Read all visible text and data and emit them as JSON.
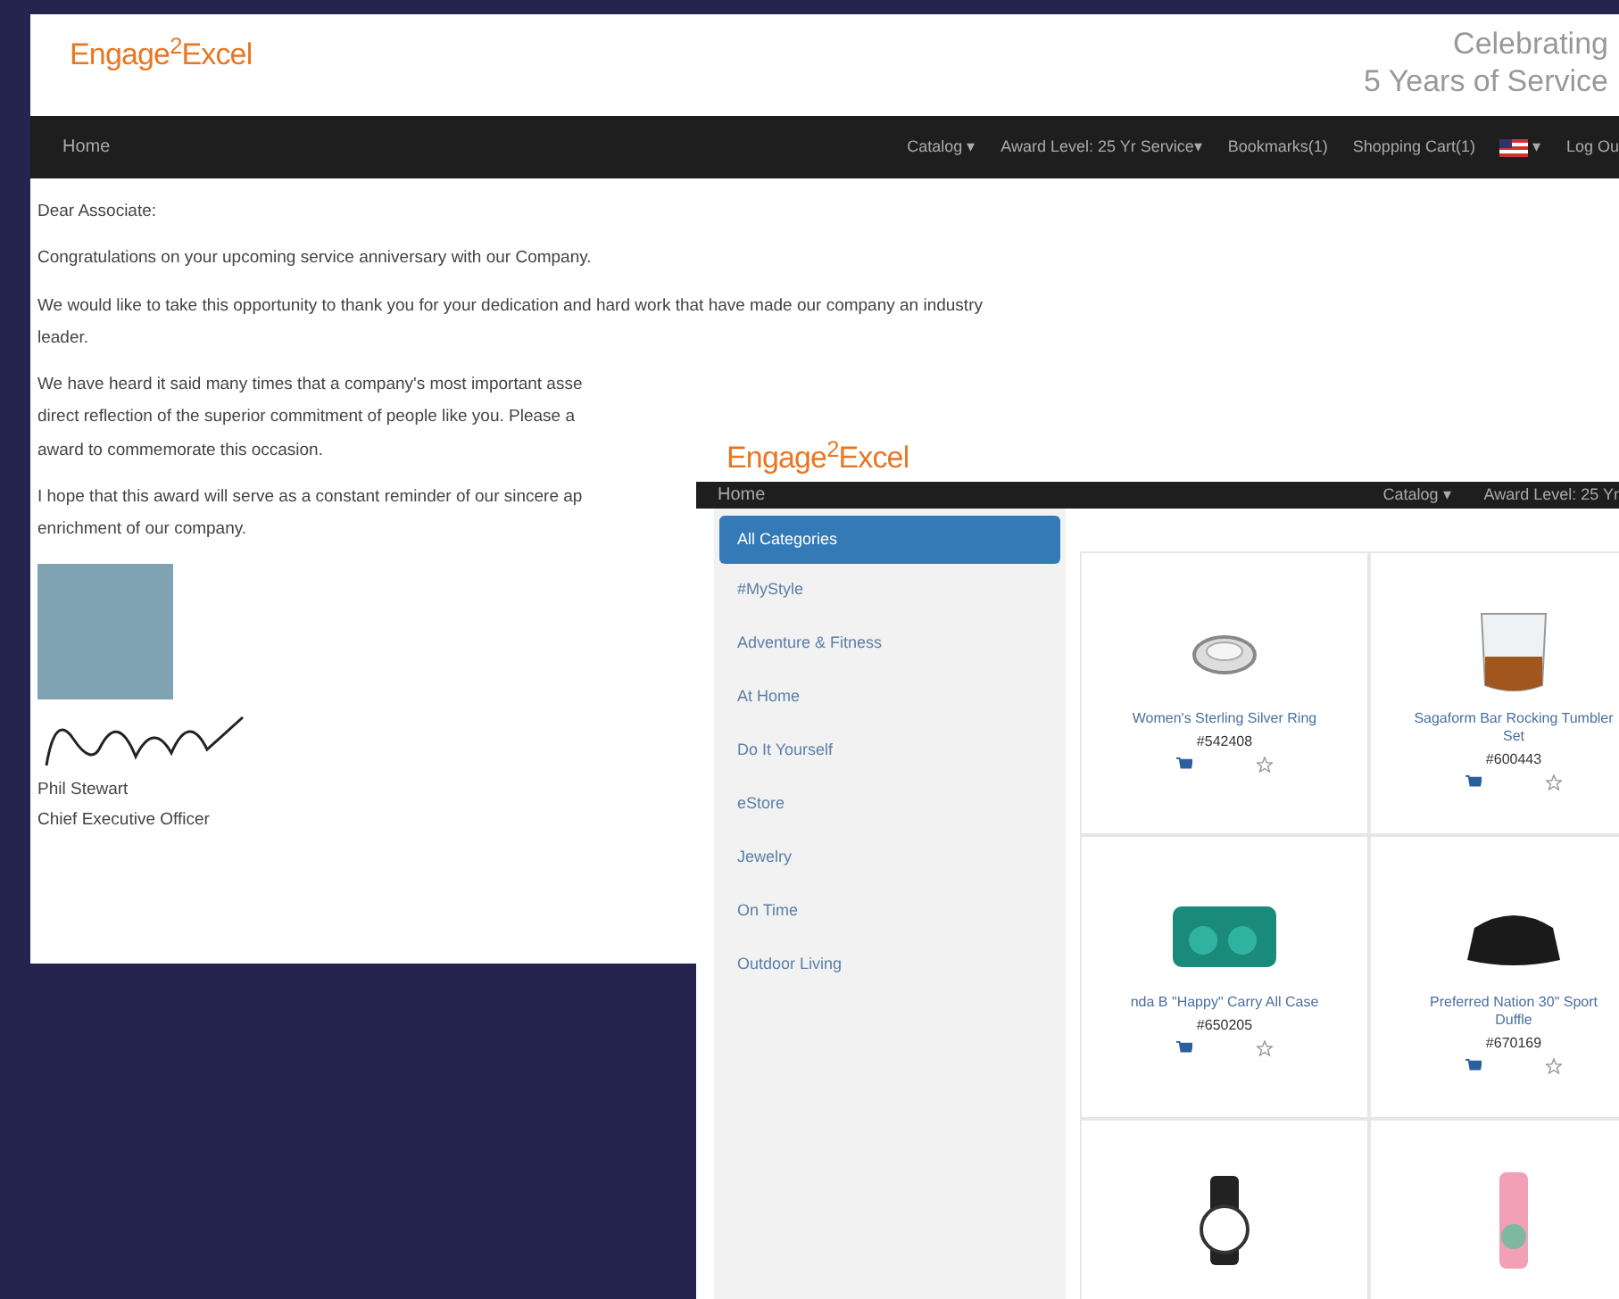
{
  "letter_window": {
    "logo": "Engage$^{2}$Excel",
    "tagline": [
      "Celebrating",
      "5 Years of Service"
    ],
    "nav": {
      "home": "Home",
      "items": [
        {
          "kind": "text",
          "label": "Catalog ▾"
        },
        {
          "kind": "text",
          "label": "Award Level: 25 Yr Service▾"
        },
        {
          "kind": "text",
          "label": "Bookmarks(1)"
        },
        {
          "kind": "text",
          "label": "Shopping Cart(1)"
        },
        {
          "kind": "flag",
          "label": "▾"
        },
        {
          "kind": "text",
          "label": "Log Ou"
        }
      ]
    },
    "greeting": "Dear Associate:",
    "paragraphs": [
      [
        "Congratulations on your upcoming service anniversary with our Company."
      ],
      [
        "We would like to take this opportunity to thank you for your dedication and hard work that have made our company an industry",
        "leader."
      ],
      [
        "We have heard it said many times that a company's most important asse",
        "direct reflection of the superior commitment of people like you. Please a",
        "award to commemorate this occasion."
      ],
      [
        "I hope that this award will serve as a constant reminder of our sincere ap",
        "enrichment of our company."
      ]
    ],
    "signer": {
      "name": "Phil Stewart",
      "title": "Chief Executive Officer"
    }
  },
  "catalog_window": {
    "logo": "Engage$^{2}$Excel",
    "nav": {
      "home": "Home",
      "items": [
        "Catalog ▾",
        "Award Level: 25 Yr"
      ]
    },
    "categories": [
      {
        "label": "All Categories",
        "selected": true
      },
      {
        "label": "#MyStyle",
        "selected": false
      },
      {
        "label": "Adventure & Fitness",
        "selected": false
      },
      {
        "label": "At Home",
        "selected": false
      },
      {
        "label": "Do It Yourself",
        "selected": false
      },
      {
        "label": "eStore",
        "selected": false
      },
      {
        "label": "Jewelry",
        "selected": false
      },
      {
        "label": "On Time",
        "selected": false
      },
      {
        "label": "Outdoor Living",
        "selected": false
      }
    ],
    "products": [
      {
        "kind": "ring",
        "name": "Women's Sterling Silver Ring",
        "sku": "#542408"
      },
      {
        "kind": "glass",
        "name": "Sagaform Bar Rocking Tumbler Set",
        "sku": "#600443"
      },
      {
        "kind": "case",
        "name": "nda B \"Happy\" Carry All Case",
        "sku": "#650205"
      },
      {
        "kind": "duffle",
        "name": "Preferred Nation 30\" Sport Duffle",
        "sku": "#670169"
      },
      {
        "kind": "watch"
      },
      {
        "kind": "bottle"
      }
    ]
  }
}
